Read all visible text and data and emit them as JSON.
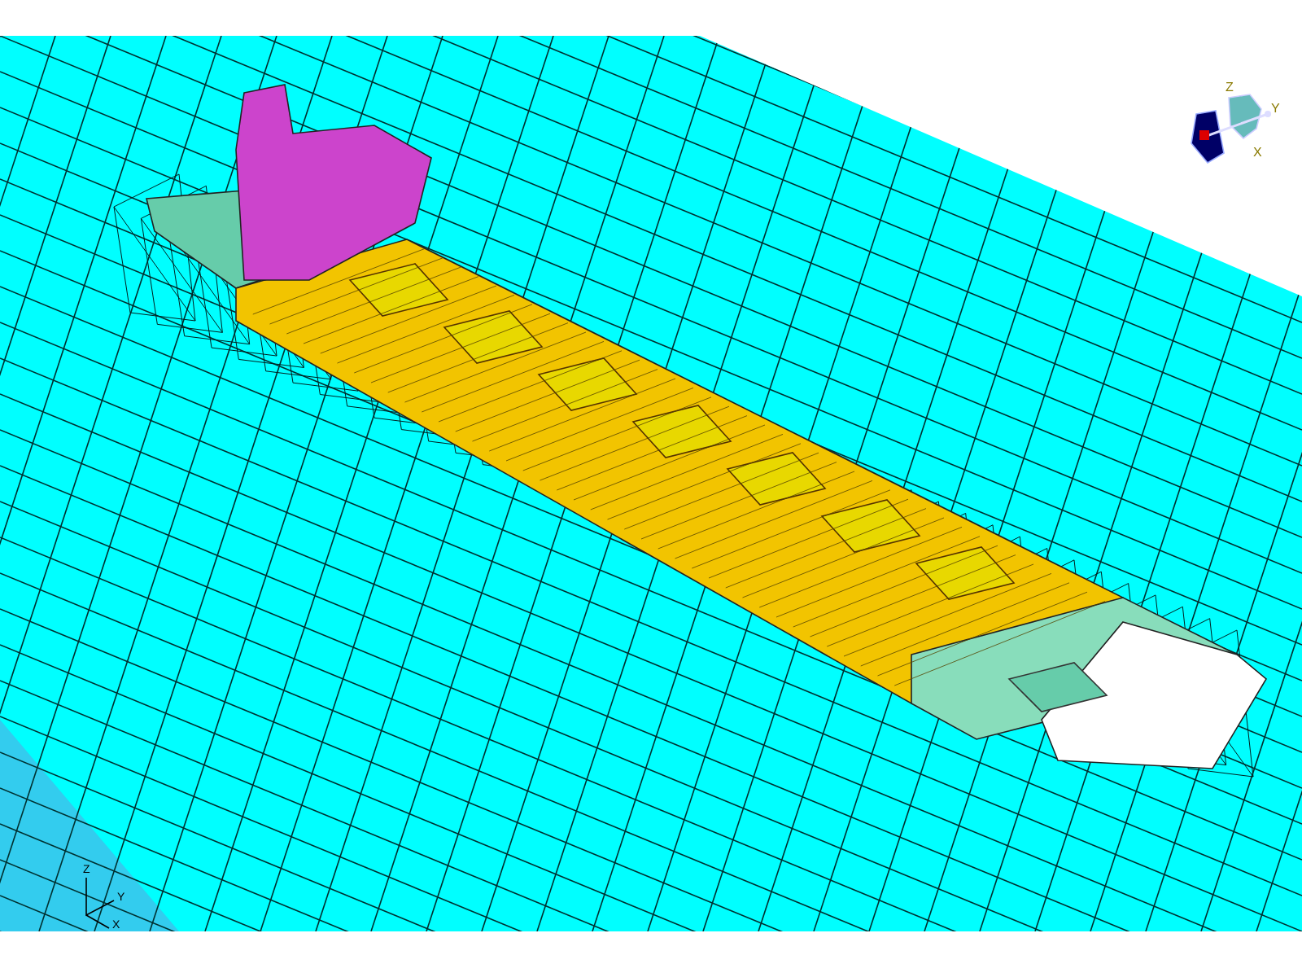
{
  "view_cube": {
    "labels": [
      "Z",
      "Y",
      "X"
    ]
  },
  "triad": {
    "labels": [
      "Z",
      "Y",
      "X"
    ]
  }
}
